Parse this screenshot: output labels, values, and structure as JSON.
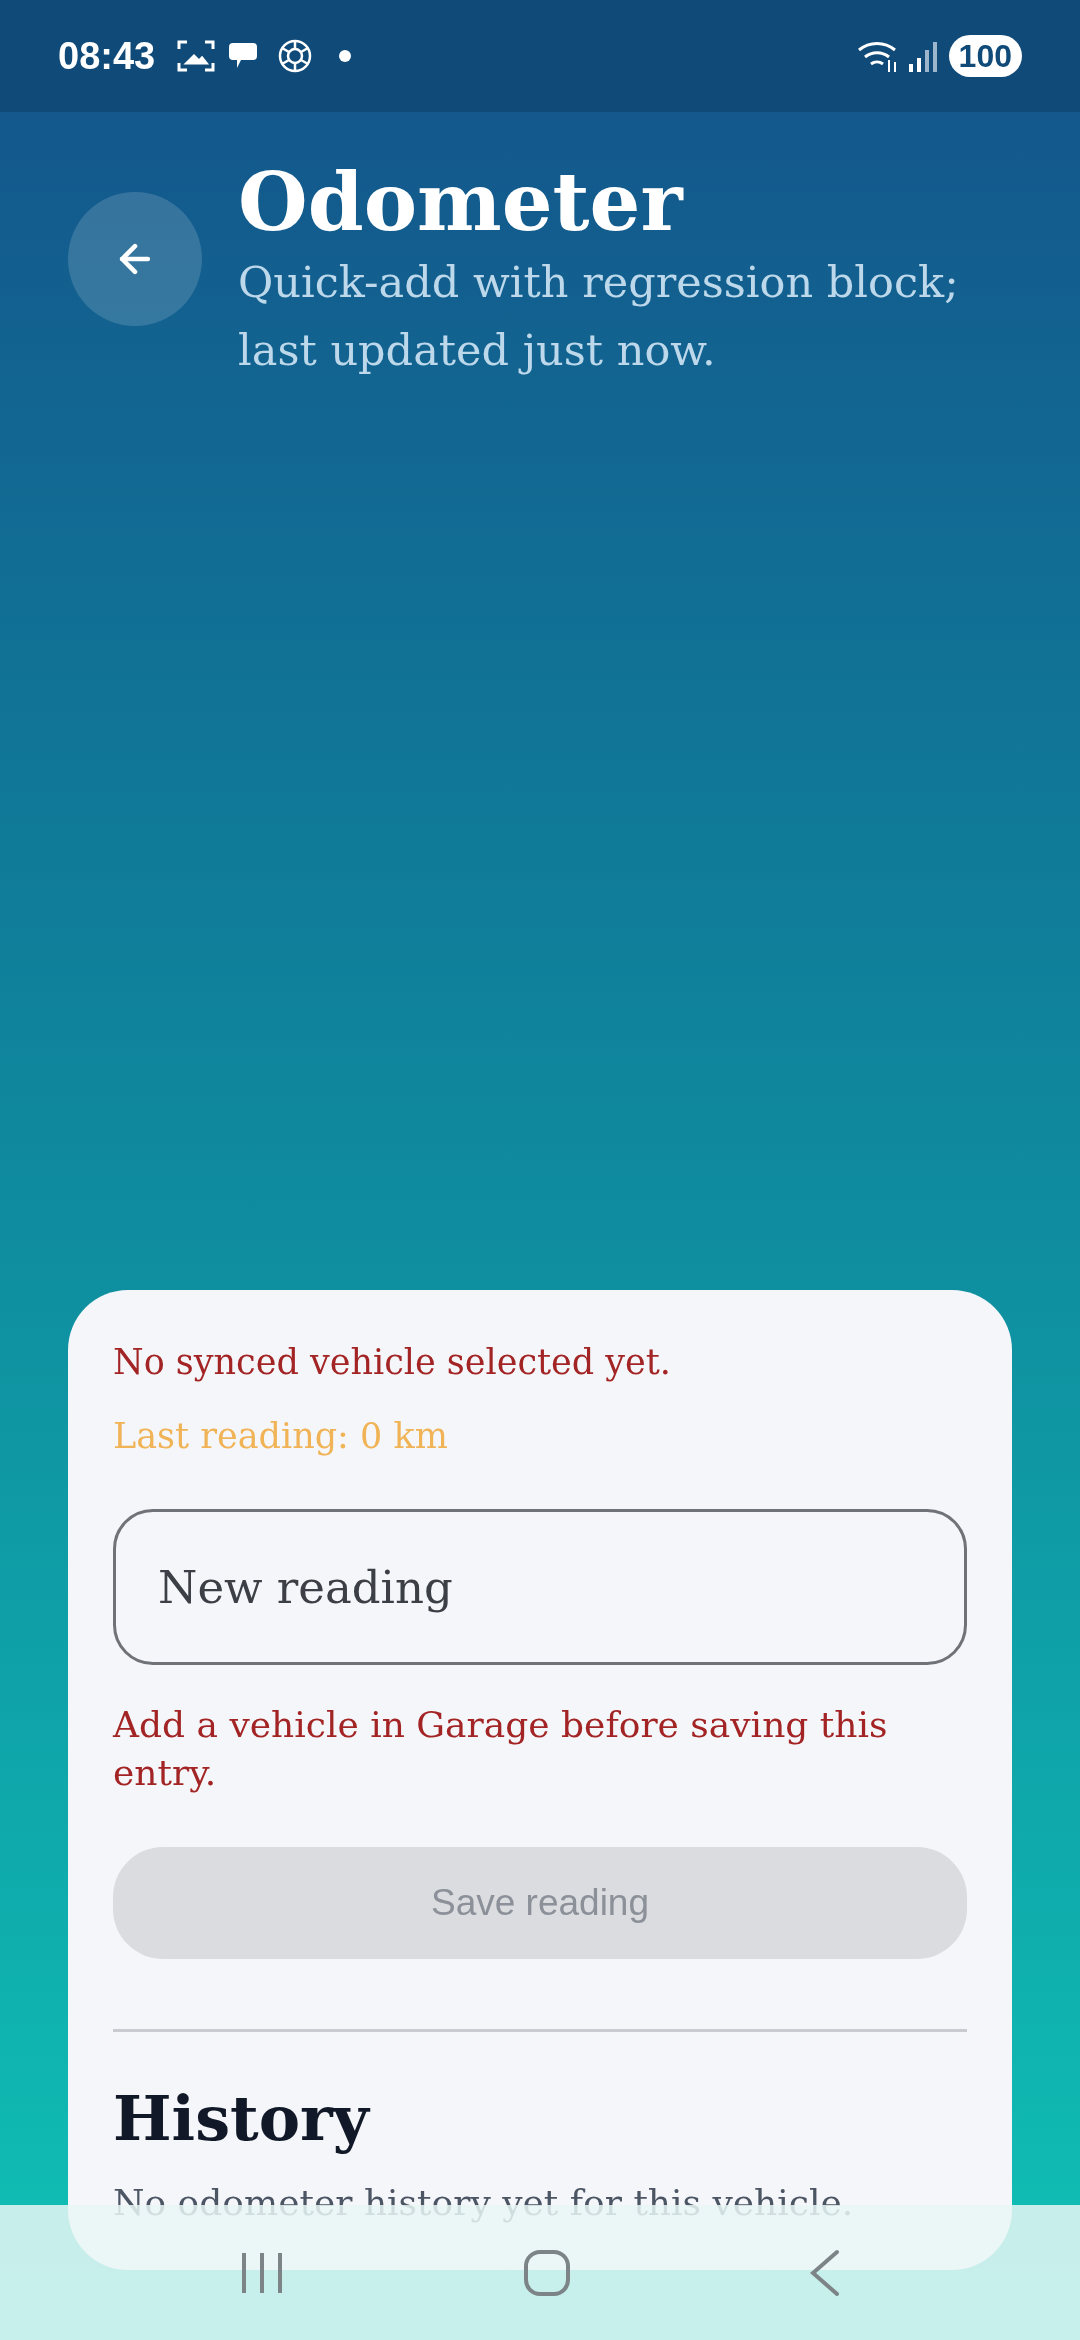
{
  "status_bar": {
    "time": "08:43",
    "battery": "100"
  },
  "header": {
    "title": "Odometer",
    "subtitle": "Quick-add with regression block; last updated just now."
  },
  "card": {
    "notice": "No synced vehicle selected yet.",
    "last_reading": "Last reading: 0 km",
    "field": {
      "placeholder": "New reading"
    },
    "error": "Add a vehicle in Garage before saving this entry.",
    "save_button": {
      "label": "Save reading",
      "disabled": true
    },
    "history": {
      "title": "History",
      "empty": "No odometer history yet for this vehicle."
    }
  }
}
